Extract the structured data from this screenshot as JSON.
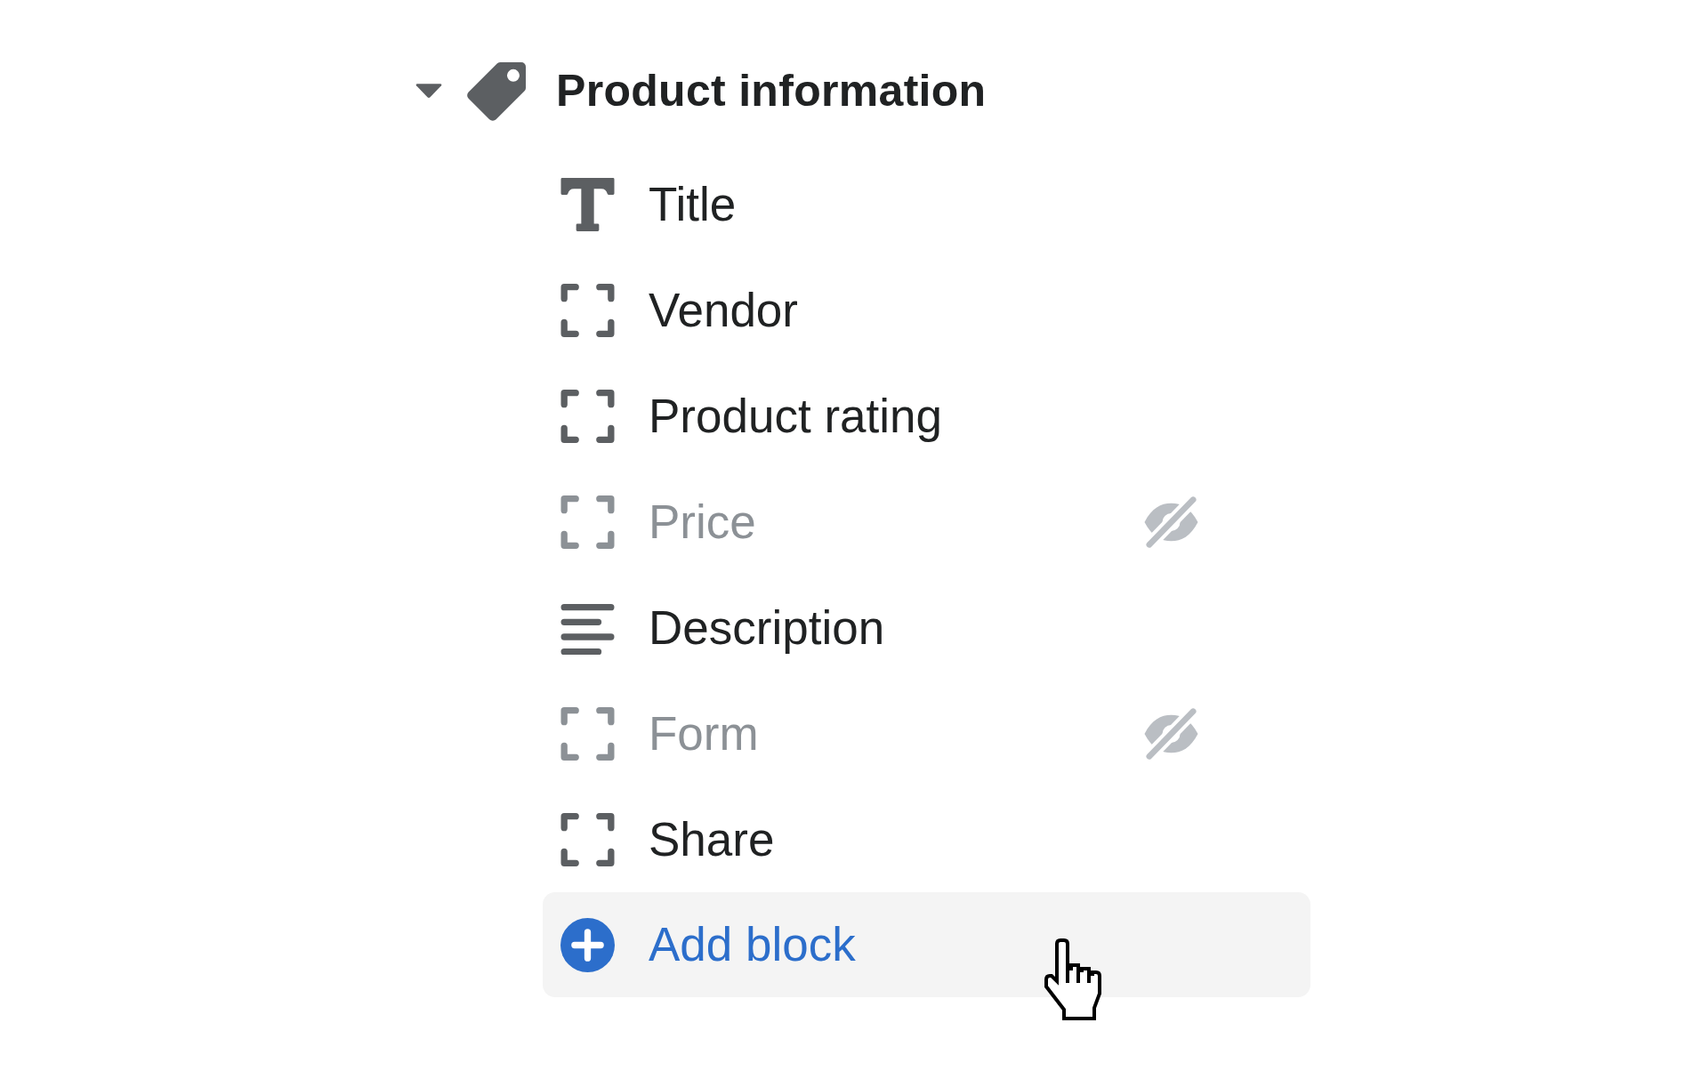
{
  "section": {
    "title": "Product information",
    "expanded": true,
    "blocks": [
      {
        "label": "Title",
        "kind": "heading",
        "hidden": false
      },
      {
        "label": "Vendor",
        "kind": "custom",
        "hidden": false
      },
      {
        "label": "Product rating",
        "kind": "custom",
        "hidden": false
      },
      {
        "label": "Price",
        "kind": "custom",
        "hidden": true
      },
      {
        "label": "Description",
        "kind": "paragraph",
        "hidden": false
      },
      {
        "label": "Form",
        "kind": "custom",
        "hidden": true
      },
      {
        "label": "Share",
        "kind": "custom",
        "hidden": false
      }
    ],
    "add_block": {
      "label": "Add block",
      "hovered": true
    }
  }
}
